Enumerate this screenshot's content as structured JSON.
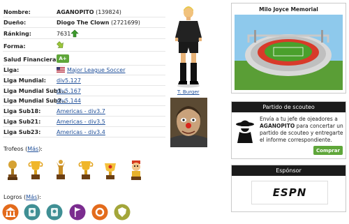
{
  "player": {
    "rows": [
      {
        "label": "Nombre:",
        "name": "AGANOPITO",
        "extra": "(139824)"
      },
      {
        "label": "Dueño:",
        "name": "Diogo The Clown",
        "extra": "(2721699)"
      },
      {
        "label": "Ránking:",
        "value": "7631"
      },
      {
        "label": "Forma:"
      },
      {
        "label": "Salud Financiera:",
        "value": "A+"
      },
      {
        "label": "Liga:",
        "link": "Major League Soccer"
      },
      {
        "label": "Liga Mundial:",
        "link": "div5.127"
      },
      {
        "label": "Liga Mundial Sub1..",
        "link": "div5.167"
      },
      {
        "label": "Liga Mundial Sub2..",
        "link": "div5.144"
      },
      {
        "label": "Liga Sub18:",
        "link": "Americas - div3.7"
      },
      {
        "label": "Liga Sub21:",
        "link": "Americas - div3.5"
      },
      {
        "label": "Liga Sub23:",
        "link": "Americas - div3.4"
      }
    ],
    "trainer_name": "T. Burger"
  },
  "trophies": {
    "title": "Trofeos",
    "more": "Más"
  },
  "achievements": {
    "title": "Logros",
    "more": "Más"
  },
  "stadium": {
    "title": "Milo Joyce Memorial"
  },
  "scouting": {
    "title": "Partido de scouteo",
    "text_before": "Envía a tu jefe de ojeadores a ",
    "club": "AGANOPITO",
    "text_after": " para concertar un partido de scouteo y entregarte el informe correspondiente.",
    "button": "Comprar"
  },
  "sponsor": {
    "title": "Espónsor",
    "brand": "ESPN"
  },
  "colors": {
    "green_badge": "#5fa63a",
    "panel_header": "#1b1b1b",
    "link": "#1f4f99"
  }
}
